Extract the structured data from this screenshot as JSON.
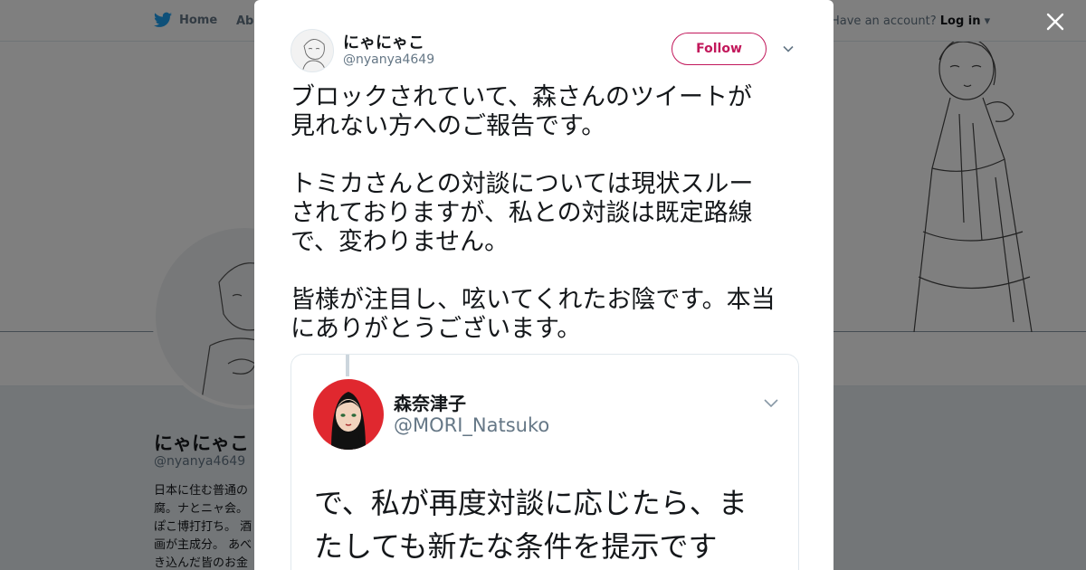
{
  "nav": {
    "home_label": "Home",
    "about_label": "About",
    "account_prompt": "Have an account?",
    "login_label": "Log in"
  },
  "profile": {
    "name": "にゃにゃこ",
    "handle": "@nyanya4649",
    "bio_lines": [
      "日本に住む普通の",
      "腐。ナとニャ会。",
      "ぽこ博打打ち。 酒",
      "画が主成分。 あべ",
      "き込んだ皆のお金"
    ]
  },
  "tweet": {
    "author_name": "にゃにゃこ",
    "author_handle": "@nyanya4649",
    "follow_label": "Follow",
    "paragraphs": [
      "ブロックされていて、森さんのツイートが\n見れない方へのご報告です。",
      "トミカさんとの対談については現状スルー\nされておりますが、私との対談は既定路線\nで、変わりません。",
      "皆様が注目し、呟いてくれたお陰です。本当\nにありがとうございます。"
    ]
  },
  "quoted": {
    "name": "森奈津子",
    "handle": "@MORI_Natsuko",
    "text": "で、私が再度対談に応じたら、ま\nたしても新たな条件を提示です"
  },
  "colors": {
    "follow_accent": "#c2185b",
    "twitter_blue": "#1da1f2",
    "avatar_red": "#e0282f"
  },
  "icons": [
    "twitter-bird-icon",
    "close-icon",
    "chevron-down-icon"
  ]
}
